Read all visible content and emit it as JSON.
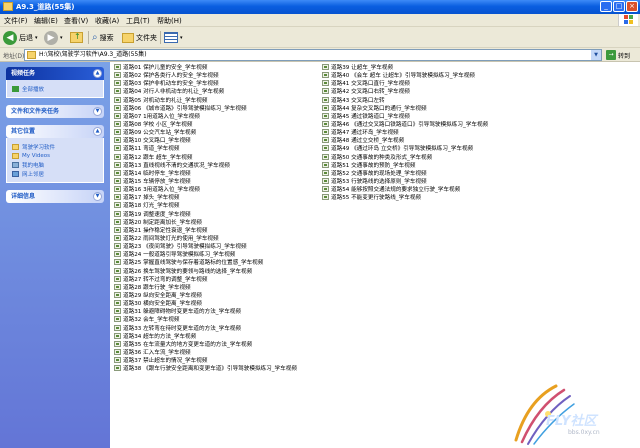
{
  "window": {
    "title": "A9.3_道路(55集)"
  },
  "menu": {
    "items": [
      "文件(F)",
      "编辑(E)",
      "查看(V)",
      "收藏(A)",
      "工具(T)",
      "帮助(H)"
    ]
  },
  "toolbar": {
    "back": "后退",
    "search": "搜索",
    "folders": "文件夹"
  },
  "address": {
    "label": "地址(D)",
    "value": "H:\\驾校\\驾驶学习软件\\A9.3_道路(55集)",
    "go": "转到"
  },
  "sidebar": {
    "video_tasks": {
      "title": "视频任务",
      "items": [
        "全部播放"
      ]
    },
    "file_tasks": {
      "title": "文件和文件夹任务"
    },
    "other_places": {
      "title": "其它位置",
      "items": [
        "驾驶学习软件",
        "My Videos",
        "我的电脑",
        "网上邻居"
      ]
    },
    "details": {
      "title": "详细信息"
    }
  },
  "files": [
    "道路01 保护儿童的安全_学车视频",
    "道路02 保护各类行人的安全_学车视频",
    "道路03 保护非机动车的安全_学车视频",
    "道路04 对行人非机动车的礼让_学车视频",
    "道路05 对机动车的礼让_学车视频",
    "道路06 《城市道路》引导驾驶模拟练习_学车视频",
    "道路07 1用道路入位_学车视频",
    "道路08 学校 小区_学车视频",
    "道路09 公交汽车站_学车视频",
    "道路10 交叉路口_学车视频",
    "道路11 弯道_学车视频",
    "道路12 跟车 超车_学车视频",
    "道路13 直线视线不清的交通状况_学车视频",
    "道路14 临时停车_学车视频",
    "道路15 车辆停放_学车视频",
    "道路16 3用道路入位_学车视频",
    "道路17 掉头_学车视频",
    "道路18 灯光_学车视频",
    "道路19 调整速度_学车视频",
    "道路20 制定距离加长_学车视频",
    "道路21 操作稳定性衰退_学车视频",
    "道路22 雨间驾驶灯光的使用_学车视频",
    "道路23 《夜间驾驶》引导驾驶模拟练习_学车视频",
    "道路24 一般道路引导驾驶模拟练习_学车视频",
    "道路25 掌握直线驾驶与保存着道路标的位置感_学车视频",
    "道路26 换车驾驶驾驶的要领与路线的选择_学车视频",
    "道路27 转不过弯的调整_学车视频",
    "道路28 跟车行驶_学车视频",
    "道路29 纵向安全距离_学车视频",
    "道路30 横向安全距离_学车视频",
    "道路31 躲避障碍物时变更车道的方法_学车视频",
    "道路32 会车_学车视频",
    "道路33 左转弯在待时变更车道的方法_学车视频",
    "道路34 超车的方法_学车视频",
    "道路35 在车流量大的地方变更车道的方法_学车视频",
    "道路36 汇入车流_学车视频",
    "道路37 禁止超车的情况_学车视频",
    "道路38 《跟车行驶安全距离和变更车道》引导驾驶模拟练习_学车视频",
    "道路39 让超车_学车视频",
    "道路40 《会车 超车 让超车》引导驾驶模拟练习_学车视频",
    "道路41 交叉路口直行_学车视频",
    "道路42 交叉路口右转_学车视频",
    "道路43 交叉路口左转",
    "道路44 复杂交叉路口的通行_学车视频",
    "道路45 通过铁路道口_学车视频",
    "道路46 《通过交叉路口铁路道口》引导驾驶模拟练习_学车视频",
    "道路47 通过环岛_学车视频",
    "道路48 通过立交桥_学车视频",
    "道路49 《通过环岛 立交桥》引导驾驶模拟练习_学车视频",
    "道路50 交通事故的种类及形式_学车视频",
    "道路51 交通事故的预防_学车视频",
    "道路52 交通事故的现场处理_学车视频",
    "道路53 行驶路线的选择原则_学车视频",
    "道路54 能够按照交通法规的要求独立行驶_学车视频",
    "道路55 不能变更行驶路线_学车视频"
  ],
  "watermark": {
    "brand": "FLY社区",
    "site": "bbs.0xy.cn"
  },
  "colors": {
    "title_bar": "#0a5ee0",
    "sidebar_bg": "#7ba2e7",
    "link": "#215dc6"
  }
}
